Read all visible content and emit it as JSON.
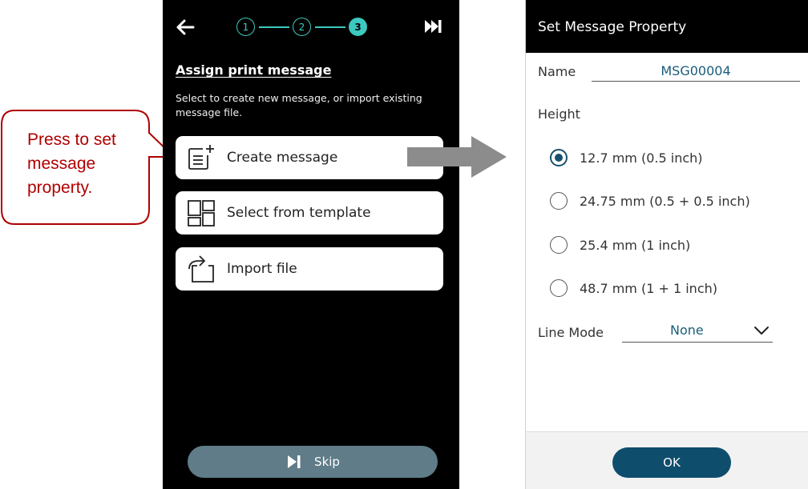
{
  "callout": {
    "text": "Press to set message property."
  },
  "setup": {
    "steps": [
      "1",
      "2",
      "3"
    ],
    "active_step": 3,
    "title": "Assign print message",
    "description": "Select to create new message, or import existing message file.",
    "options": [
      {
        "label": "Create message",
        "icon": "new-document-icon"
      },
      {
        "label": "Select from template",
        "icon": "template-grid-icon"
      },
      {
        "label": "Import file",
        "icon": "import-file-icon"
      }
    ],
    "skip_label": "Skip"
  },
  "dialog": {
    "title": "Set Message Property",
    "name_label": "Name",
    "name_value": "MSG00004",
    "height_label": "Height",
    "height_options": [
      {
        "label": "12.7 mm (0.5 inch)",
        "checked": true
      },
      {
        "label": "24.75 mm (0.5 + 0.5 inch)",
        "checked": false
      },
      {
        "label": "25.4 mm (1 inch)",
        "checked": false
      },
      {
        "label": "48.7 mm (1 + 1 inch)",
        "checked": false
      }
    ],
    "line_mode_label": "Line Mode",
    "line_mode_value": "None",
    "ok_label": "OK"
  },
  "colors": {
    "accent_teal": "#3cc9c0",
    "primary_blue": "#0f4d6c",
    "callout_red": "#b00000",
    "skip_gray": "#5f7c88"
  }
}
